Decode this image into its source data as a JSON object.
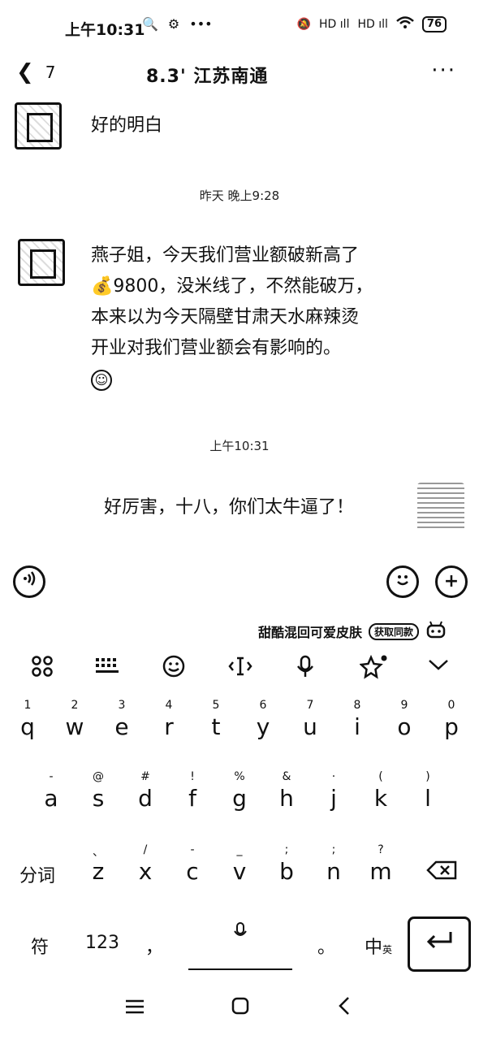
{
  "status_bar": {
    "time": "上午10:31",
    "left_icons": [
      "🔍",
      "⚙",
      "•••"
    ],
    "right_icons": [
      "🔕",
      "HD ıll",
      "HD ıll",
      "wifi"
    ],
    "battery": "76"
  },
  "header": {
    "back_count": "7",
    "title": "8.3' 江苏南通",
    "more": "···"
  },
  "messages": [
    {
      "text": "好的明白"
    },
    {
      "timestamp": "昨天 晚上9:28"
    },
    {
      "lines": [
        "燕子姐，今天我们营业额破新高了",
        "💰9800，没米线了，不然能破万，",
        "本来以为今天隔壁甘肃天水麻辣烫",
        "开业对我们营业额会有影响的。"
      ],
      "emoji": "☺"
    },
    {
      "timestamp": "上午10:31"
    },
    {
      "text": "好厉害，十八，你们太牛逼了！"
    }
  ],
  "input_bar": {
    "voice_icon": "voice-icon",
    "emoji_icon": "emoji-icon",
    "plus_icon": "plus-icon"
  },
  "keyboard": {
    "banner_text": "甜酷混回可爱皮肤",
    "banner_chip": "获取同款",
    "row1": [
      {
        "num": "1",
        "letter": "q"
      },
      {
        "num": "2",
        "letter": "w"
      },
      {
        "num": "3",
        "letter": "e"
      },
      {
        "num": "4",
        "letter": "r"
      },
      {
        "num": "5",
        "letter": "t"
      },
      {
        "num": "6",
        "letter": "y"
      },
      {
        "num": "7",
        "letter": "u"
      },
      {
        "num": "8",
        "letter": "i"
      },
      {
        "num": "9",
        "letter": "o"
      },
      {
        "num": "0",
        "letter": "p"
      }
    ],
    "row2": [
      {
        "sym": "-",
        "letter": "a"
      },
      {
        "sym": "@",
        "letter": "s"
      },
      {
        "sym": "#",
        "letter": "d"
      },
      {
        "sym": "!",
        "letter": "f"
      },
      {
        "sym": "%",
        "letter": "g"
      },
      {
        "sym": "&",
        "letter": "h"
      },
      {
        "sym": "·",
        "letter": "j"
      },
      {
        "sym": "(",
        "letter": "k"
      },
      {
        "sym": ")",
        "letter": "l"
      }
    ],
    "row3": [
      {
        "sym": "、",
        "letter": "z"
      },
      {
        "sym": "/",
        "letter": "x"
      },
      {
        "sym": "-",
        "letter": "c"
      },
      {
        "sym": "_",
        "letter": "v"
      },
      {
        "sym": ";",
        "letter": "b"
      },
      {
        "sym": ";",
        "letter": "n"
      },
      {
        "sym": "?",
        "letter": "m"
      }
    ],
    "fenci": "分词",
    "fu": "符",
    "num123": "123",
    "comma": "，",
    "period": "。",
    "zhong": "中",
    "ying": "英",
    "mic_small": "🎤"
  }
}
